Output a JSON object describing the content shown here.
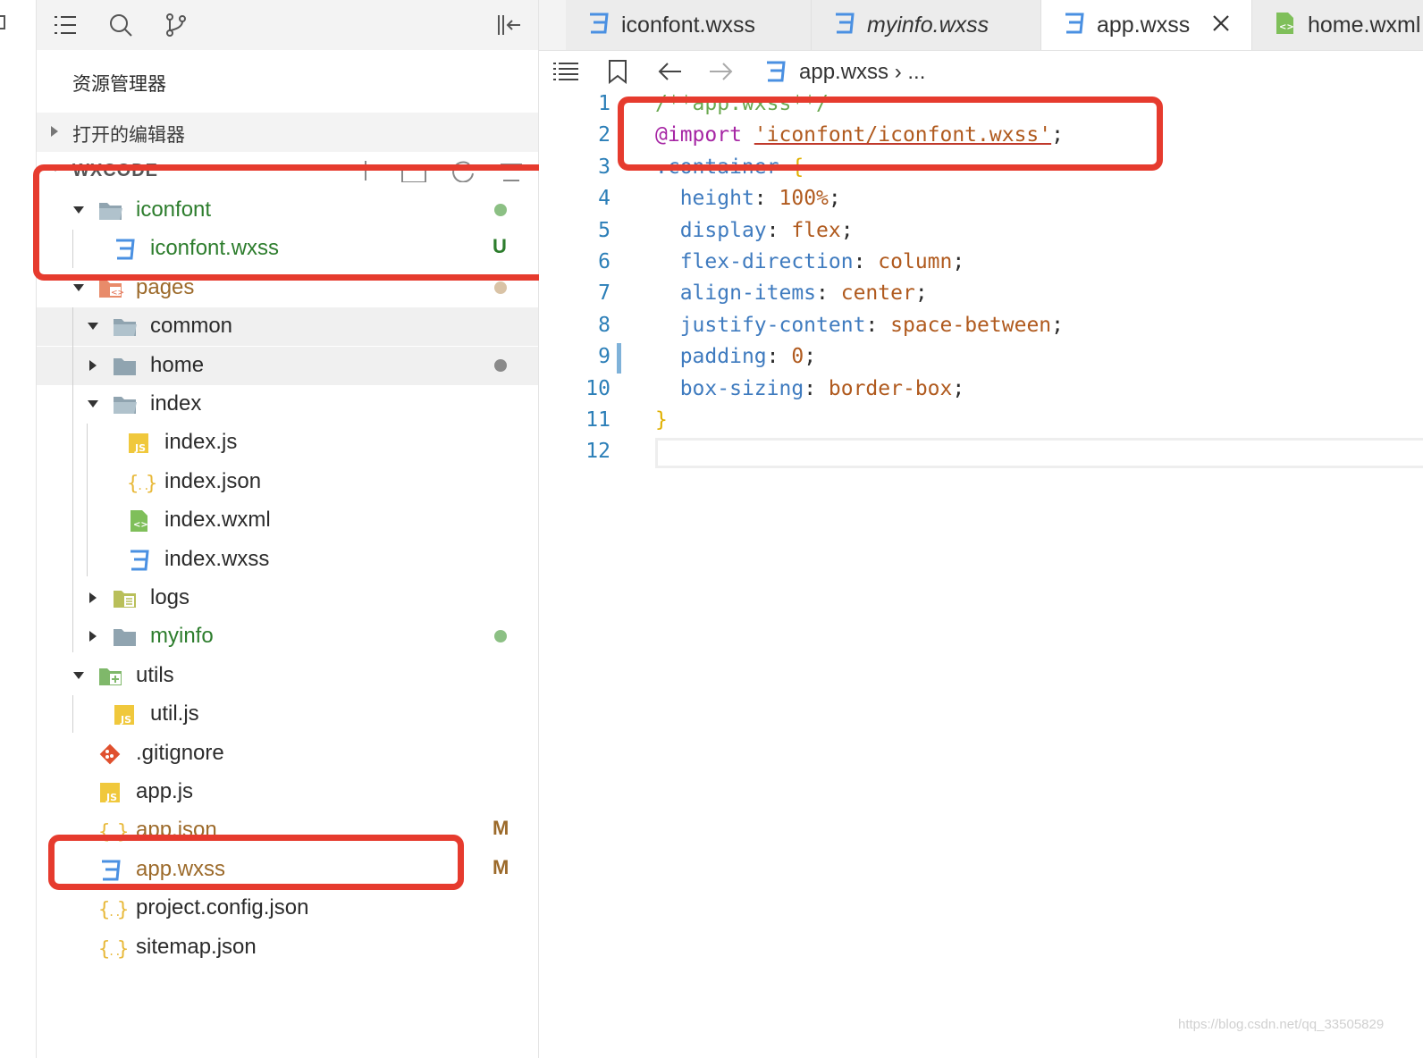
{
  "sidebar": {
    "title": "资源管理器",
    "open_editors": "打开的编辑器",
    "workspace": "WXCODE",
    "tree": [
      {
        "name": "iconfont",
        "type": "folder-open",
        "depth": 0,
        "caret": "down",
        "color": "#2d7d2d",
        "dot": "#8cc084"
      },
      {
        "name": "iconfont.wxss",
        "type": "wxss",
        "depth": 1,
        "caret": "none",
        "color": "#2d7d2d",
        "badge": "U",
        "badge_color": "#2d7d2d"
      },
      {
        "name": "pages",
        "type": "folder-pages",
        "depth": 0,
        "caret": "down",
        "color": "#9c6a2a",
        "dot": "#d9c3a6"
      },
      {
        "name": "common",
        "type": "folder-open",
        "depth": 1,
        "caret": "down",
        "color": "#2b2b2b",
        "highlight": true
      },
      {
        "name": "home",
        "type": "folder",
        "depth": 1,
        "caret": "right",
        "color": "#2b2b2b",
        "dot": "#8a8a8a",
        "highlight": true
      },
      {
        "name": "index",
        "type": "folder-open",
        "depth": 1,
        "caret": "down",
        "color": "#2b2b2b"
      },
      {
        "name": "index.js",
        "type": "js",
        "depth": 2,
        "caret": "none",
        "color": "#2b2b2b"
      },
      {
        "name": "index.json",
        "type": "json",
        "depth": 2,
        "caret": "none",
        "color": "#2b2b2b"
      },
      {
        "name": "index.wxml",
        "type": "wxml",
        "depth": 2,
        "caret": "none",
        "color": "#2b2b2b"
      },
      {
        "name": "index.wxss",
        "type": "wxss",
        "depth": 2,
        "caret": "none",
        "color": "#2b2b2b"
      },
      {
        "name": "logs",
        "type": "folder-logs",
        "depth": 1,
        "caret": "right",
        "color": "#2b2b2b"
      },
      {
        "name": "myinfo",
        "type": "folder",
        "depth": 1,
        "caret": "right",
        "color": "#2d7d2d",
        "dot": "#8cc084"
      },
      {
        "name": "utils",
        "type": "folder-utils",
        "depth": 0,
        "caret": "down",
        "color": "#2b2b2b"
      },
      {
        "name": "util.js",
        "type": "js",
        "depth": 1,
        "caret": "none",
        "color": "#2b2b2b"
      },
      {
        "name": ".gitignore",
        "type": "git",
        "depth": 0,
        "caret": "none",
        "color": "#2b2b2b"
      },
      {
        "name": "app.js",
        "type": "js",
        "depth": 0,
        "caret": "none",
        "color": "#2b2b2b"
      },
      {
        "name": "app.json",
        "type": "json",
        "depth": 0,
        "caret": "none",
        "color": "#9c6a2a",
        "badge": "M",
        "badge_color": "#9c6a2a"
      },
      {
        "name": "app.wxss",
        "type": "wxss",
        "depth": 0,
        "caret": "none",
        "color": "#9c6a2a",
        "badge": "M",
        "badge_color": "#9c6a2a"
      },
      {
        "name": "project.config.json",
        "type": "json",
        "depth": 0,
        "caret": "none",
        "color": "#2b2b2b"
      },
      {
        "name": "sitemap.json",
        "type": "json",
        "depth": 0,
        "caret": "none",
        "color": "#2b2b2b"
      }
    ]
  },
  "tabs": [
    {
      "label": "iconfont.wxss",
      "icon": "css-icon",
      "italic": false,
      "active": false
    },
    {
      "label": "myinfo.wxss",
      "icon": "css-icon",
      "italic": true,
      "active": false
    },
    {
      "label": "app.wxss",
      "icon": "css-icon",
      "italic": false,
      "active": true,
      "close": "×"
    },
    {
      "label": "home.wxml",
      "icon": "wxml-icon",
      "italic": false,
      "active": false
    }
  ],
  "breadcrumb": {
    "file": "app.wxss",
    "sep": "›",
    "more": "..."
  },
  "code": [
    {
      "n": "1",
      "html": [
        [
          "c-com",
          "/**app.wxss**/"
        ]
      ]
    },
    {
      "n": "2",
      "html": [
        [
          "c-kw",
          "@import "
        ],
        [
          "c-str",
          "'iconfont/iconfont.wxss'"
        ],
        [
          "c-punc",
          ";"
        ]
      ]
    },
    {
      "n": "3",
      "html": [
        [
          "c-sel",
          ".container "
        ],
        [
          "c-brace",
          "{"
        ]
      ]
    },
    {
      "n": "4",
      "html": [
        [
          "c-punc",
          "  "
        ],
        [
          "c-prop",
          "height"
        ],
        [
          "c-punc",
          ": "
        ],
        [
          "c-val",
          "100%"
        ],
        [
          "c-punc",
          ";"
        ]
      ]
    },
    {
      "n": "5",
      "html": [
        [
          "c-punc",
          "  "
        ],
        [
          "c-prop",
          "display"
        ],
        [
          "c-punc",
          ": "
        ],
        [
          "c-val",
          "flex"
        ],
        [
          "c-punc",
          ";"
        ]
      ]
    },
    {
      "n": "6",
      "html": [
        [
          "c-punc",
          "  "
        ],
        [
          "c-prop",
          "flex-direction"
        ],
        [
          "c-punc",
          ": "
        ],
        [
          "c-val",
          "column"
        ],
        [
          "c-punc",
          ";"
        ]
      ]
    },
    {
      "n": "7",
      "html": [
        [
          "c-punc",
          "  "
        ],
        [
          "c-prop",
          "align-items"
        ],
        [
          "c-punc",
          ": "
        ],
        [
          "c-val",
          "center"
        ],
        [
          "c-punc",
          ";"
        ]
      ]
    },
    {
      "n": "8",
      "html": [
        [
          "c-punc",
          "  "
        ],
        [
          "c-prop",
          "justify-content"
        ],
        [
          "c-punc",
          ": "
        ],
        [
          "c-val",
          "space-between"
        ],
        [
          "c-punc",
          ";"
        ]
      ]
    },
    {
      "n": "9",
      "html": [
        [
          "c-punc",
          "  "
        ],
        [
          "c-prop",
          "padding"
        ],
        [
          "c-punc",
          ": "
        ],
        [
          "c-val",
          "0"
        ],
        [
          "c-punc",
          ";"
        ]
      ]
    },
    {
      "n": "10",
      "html": [
        [
          "c-punc",
          "  "
        ],
        [
          "c-prop",
          "box-sizing"
        ],
        [
          "c-punc",
          ": "
        ],
        [
          "c-val",
          "border-box"
        ],
        [
          "c-punc",
          ";"
        ]
      ]
    },
    {
      "n": "11",
      "html": [
        [
          "c-brace",
          "}"
        ]
      ]
    },
    {
      "n": "12",
      "html": []
    }
  ],
  "watermark": "https://blog.csdn.net/qq_33505829",
  "colors": {
    "annotation_red": "#e63b2e",
    "accent_blue": "#4a90e2"
  }
}
